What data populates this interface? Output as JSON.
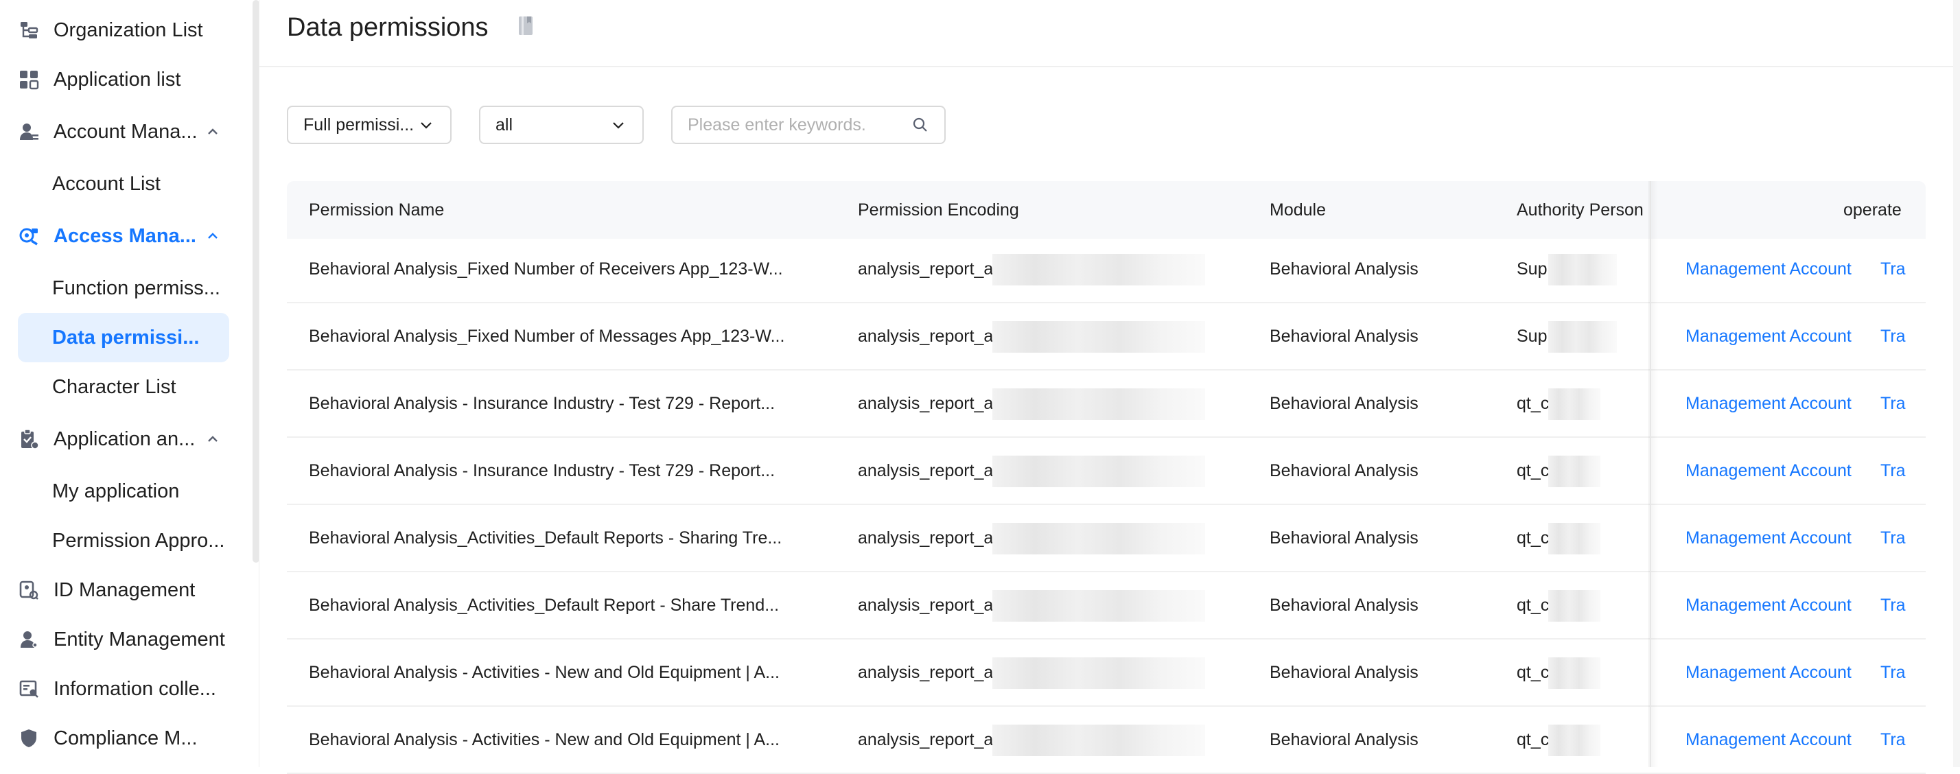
{
  "sidebar": {
    "items": [
      {
        "label": "Organization List",
        "icon": "org-tree-icon"
      },
      {
        "label": "Application list",
        "icon": "app-grid-icon"
      },
      {
        "label": "Account Mana...",
        "icon": "account-manage-icon"
      },
      {
        "label": "Account List"
      },
      {
        "label": "Access Mana...",
        "icon": "access-manage-icon"
      },
      {
        "label": "Function permiss..."
      },
      {
        "label": "Data permissi..."
      },
      {
        "label": "Character List"
      },
      {
        "label": "Application an...",
        "icon": "application-clipboard-icon"
      },
      {
        "label": "My application"
      },
      {
        "label": "Permission Appro..."
      },
      {
        "label": "ID Management",
        "icon": "id-management-icon"
      },
      {
        "label": "Entity Management",
        "icon": "entity-user-icon"
      },
      {
        "label": "Information colle...",
        "icon": "info-collect-icon"
      },
      {
        "label": "Compliance M...",
        "icon": "compliance-icon"
      }
    ]
  },
  "header": {
    "title": "Data permissions"
  },
  "filters": {
    "scope_value": "Full permissi...",
    "module_value": "all",
    "search_placeholder": "Please enter keywords."
  },
  "table": {
    "columns": [
      "Permission Name",
      "Permission Encoding",
      "Module",
      "Authority Person",
      "operate"
    ],
    "rows": [
      {
        "name": "Behavioral Analysis_Fixed Number of Receivers App_123-W...",
        "encoding": "analysis_report_a",
        "module": "Behavioral Analysis",
        "person": "Sup",
        "op1": "Management Account",
        "op2": "Tra"
      },
      {
        "name": "Behavioral Analysis_Fixed Number of Messages App_123-W...",
        "encoding": "analysis_report_a",
        "module": "Behavioral Analysis",
        "person": "Sup",
        "op1": "Management Account",
        "op2": "Tra"
      },
      {
        "name": "Behavioral Analysis - Insurance Industry - Test 729 - Report...",
        "encoding": "analysis_report_a",
        "module": "Behavioral Analysis",
        "person": "qt_c",
        "op1": "Management Account",
        "op2": "Tra"
      },
      {
        "name": "Behavioral Analysis - Insurance Industry - Test 729 - Report...",
        "encoding": "analysis_report_a",
        "module": "Behavioral Analysis",
        "person": "qt_c",
        "op1": "Management Account",
        "op2": "Tra"
      },
      {
        "name": "Behavioral Analysis_Activities_Default Reports - Sharing Tre...",
        "encoding": "analysis_report_a",
        "module": "Behavioral Analysis",
        "person": "qt_c",
        "op1": "Management Account",
        "op2": "Tra"
      },
      {
        "name": "Behavioral Analysis_Activities_Default Report - Share Trend...",
        "encoding": "analysis_report_a",
        "module": "Behavioral Analysis",
        "person": "qt_c",
        "op1": "Management Account",
        "op2": "Tra"
      },
      {
        "name": "Behavioral Analysis - Activities - New and Old Equipment | A...",
        "encoding": "analysis_report_a",
        "module": "Behavioral Analysis",
        "person": "qt_c",
        "op1": "Management Account",
        "op2": "Tra"
      },
      {
        "name": "Behavioral Analysis - Activities - New and Old Equipment | A...",
        "encoding": "analysis_report_a",
        "module": "Behavioral Analysis",
        "person": "qt_c",
        "op1": "Management Account",
        "op2": "Tra"
      }
    ]
  },
  "colors": {
    "accent": "#1677ff",
    "active_bg": "#e6f1ff"
  }
}
